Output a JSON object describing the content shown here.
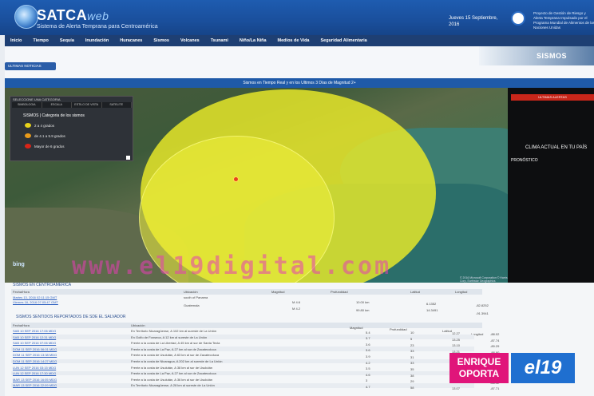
{
  "header": {
    "logo": "SATCA",
    "logo_suffix": "web",
    "subtitle": "Sistema de Alerta Temprana para Centroamérica",
    "date": "Jueves 15 Septiembre, 2016",
    "org": "Proyecto de Gestión de Riesgo y Alerta Temprana Impulsado por el Programa Mundial de Alimentos de las Naciones Unidas"
  },
  "nav": [
    "Inicio",
    "Tiempo",
    "Sequía",
    "Inundación",
    "Huracanes",
    "Sismos",
    "Volcanes",
    "Tsunami",
    "Niño/La Niña",
    "Medios de Vida",
    "Seguridad Alimentaria"
  ],
  "strip": {
    "tab": "ULTIMAS NOTICIAS",
    "banner": "SISMOS"
  },
  "map": {
    "title": "Sismos en Tiempo Real y en los Ultimos 3 Días de Magnitud 2+",
    "bing": "bing",
    "copyright": "© 2016 Microsoft Corporation © Harris Corp, Earthstar Geographics"
  },
  "legend": {
    "title": "SELECCIONE UNA CATEGORIA",
    "tabs": [
      "SIMBOLOGIA",
      "ESCALA",
      "ESTILO DE VISTA",
      "SATELITE"
    ],
    "heading": "SISMOS | Categoria de los sismos",
    "rows": [
      {
        "label": "2 a 4 grados",
        "color": "#e8d21a"
      },
      {
        "label": "de 4.1 a 5.9 grados",
        "color": "#e89a1a"
      },
      {
        "label": "Mayor de 6 grados",
        "color": "#d92418"
      }
    ]
  },
  "right_panel": {
    "header": "ULTIMAS ALERTAS",
    "clima": "CLIMA ACTUAL EN TU PAÍS",
    "pronostico": "PRONÓSTICO"
  },
  "watermark": "www.el19digital.com",
  "table1": {
    "title": "SISMOS EN CENTROAMÉRICA",
    "headers": [
      "Fecha/Hora",
      "Ubicación",
      "Magnitud",
      "Profundidad",
      "Latitud",
      "Longitud"
    ],
    "rows": [
      [
        "Martes 13, 2016 02:11:15 GMT",
        "south of Panama",
        "M 4.6",
        "10.00 km",
        "6.1352",
        "-82.8252"
      ],
      [
        "Viernes 16, 2016 07:05:47 GMT",
        "Guatemala",
        "M 4.2",
        "99.80 km",
        "14.3491",
        "-91.3941"
      ]
    ]
  },
  "table2": {
    "title": "SISMOS SENTIDOS REPORTADOS DE SDE EL SALVADOR",
    "headers": [
      "Fecha/Hora",
      "Ubicación",
      "Magnitud",
      "Profundidad",
      "Latitud",
      "Longitud"
    ],
    "rows": [
      [
        "SAB 10 SEP 2016 17:06 MDG",
        "En Territorio Nicaragüense, A 102 km al sureste de La Unión",
        "5.4",
        "10",
        "12.27",
        "-88.02"
      ],
      [
        "SAB 10 SEP 2016 12:31 MDG",
        "En Golfo de Fonseca, A 12 km al sureste de La Unión",
        "3.7",
        "5",
        "13.25",
        "-87.74"
      ],
      [
        "SAB 10 SEP 2016 07:06 MDG",
        "Frente a la costa de La Libertad, A 45 km al sur de Santa Tecla",
        "3.6",
        "23",
        "13.10",
        "-89.29"
      ],
      [
        "DOM 11 SEP 2016 06:01 MDG",
        "Frente a la costa de La Paz, A 27 km al sur de Zacatecoluca",
        "3.6",
        "33",
        "13.21",
        "-88.90"
      ],
      [
        "DOM 11 SEP 2016 13:38 MDG",
        "Frente a la costa de Usulután, A 63 km al sur de Zacatecoluca",
        "3.9",
        "31",
        "12.91",
        "-88.60"
      ],
      [
        "DOM 11 SEP 2016 14:27 MDG",
        "Frente a la costa de Nicaragua, A 202 km al sureste de La Unión",
        "4.2",
        "33",
        "11.95",
        "-86.81"
      ],
      [
        "LUN 12 SEP 2016 03:15 MDG",
        "Frente a la costa de Usulután, A 38 km al sur de Usulután",
        "3.5",
        "35",
        "13.02",
        "-88.44"
      ],
      [
        "LUN 12 SEP 2016 17:30 MDG",
        "Frente a la costa de La Paz, A 27 km al sur de Zacatecoluca",
        "4.6",
        "38",
        "13.25",
        "-88.94"
      ],
      [
        "MAR 13 SEP 2016 16:05 MDG",
        "Frente a la costa de Usulután, A 36 km al sur de Usulután",
        "3",
        "29",
        "13.04",
        "-88.42"
      ],
      [
        "MAR 13 SEP 2016 22:09 MDG",
        "En Territorio Nicaragüense, A 28 km al sureste de La Unión",
        "4.7",
        "58",
        "13.07",
        "-87.71"
      ]
    ]
  },
  "badge": {
    "line1": "ENRIQUE",
    "line2": "OPORTA",
    "logo": "el19"
  }
}
